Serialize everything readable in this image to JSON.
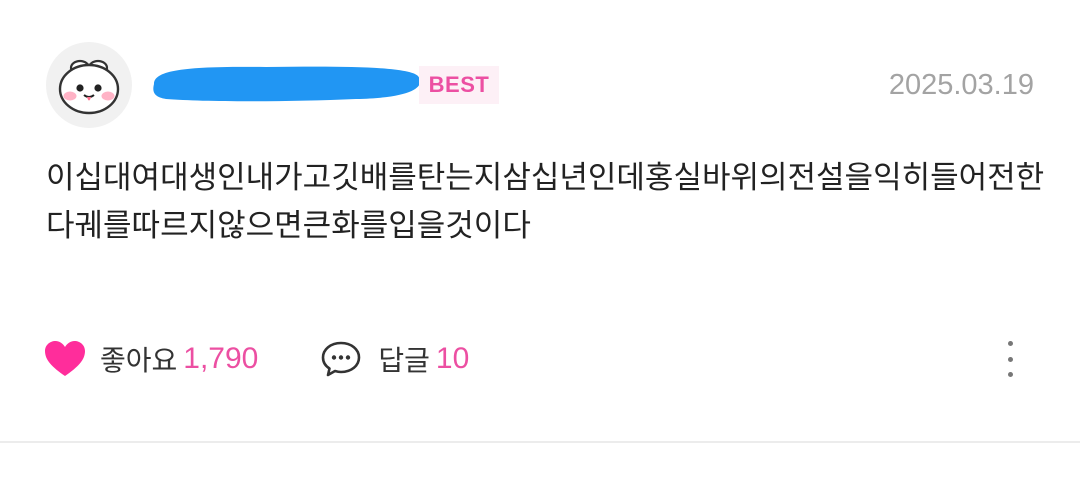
{
  "comment": {
    "badge": "BEST",
    "date": "2025.03.19",
    "text": "이십대여대생인내가고깃배를탄는지삼십년인데홍실바위의전설을익히들어전한다궤를따르지않으면큰화를입을것이다",
    "nickname_redacted": true
  },
  "actions": {
    "like_label": "좋아요",
    "like_count": "1,790",
    "reply_label": "답글",
    "reply_count": "10"
  },
  "icons": {
    "avatar": "white-bunny-avatar-icon",
    "like": "heart-icon",
    "reply": "speech-bubble-icon",
    "more": "vertical-dots-icon"
  },
  "colors": {
    "accent": "#ec4fa2",
    "heart": "#ff2d9b",
    "badge_bg": "#fdf0f6",
    "redaction": "#2196f3",
    "date": "#a3a3a3",
    "text": "#222222"
  }
}
